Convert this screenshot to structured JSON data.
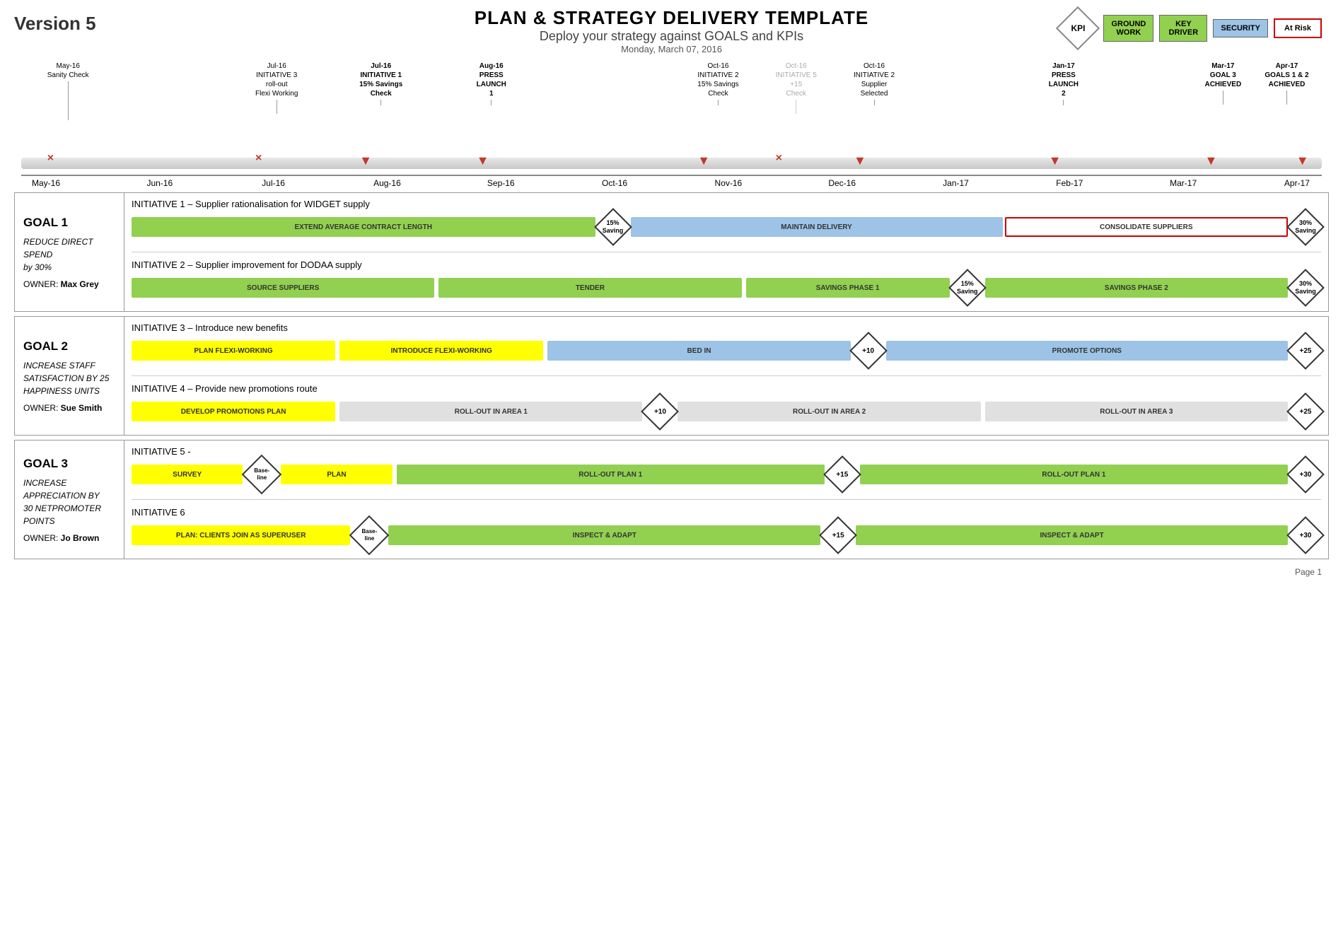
{
  "header": {
    "title": "PLAN & STRATEGY DELIVERY TEMPLATE",
    "subtitle": "Deploy your strategy against GOALS and KPIs",
    "date": "Monday, March 07, 2016",
    "version": "Version 5",
    "kpi_label": "KPI"
  },
  "legend": [
    {
      "id": "ground-work",
      "label": "GROUND\nWORK",
      "bg": "#92d050",
      "color": "#000"
    },
    {
      "id": "key-driver",
      "label": "KEY\nDRIVER",
      "bg": "#92d050",
      "color": "#000"
    },
    {
      "id": "security",
      "label": "SECURITY",
      "bg": "#9dc3e6",
      "color": "#000"
    },
    {
      "id": "at-risk",
      "label": "At Risk",
      "bg": "#fff",
      "color": "#c00",
      "border": "#c00"
    }
  ],
  "timeline": {
    "months": [
      "May-16",
      "Jun-16",
      "Jul-16",
      "Aug-16",
      "Sep-16",
      "Oct-16",
      "Nov-16",
      "Dec-16",
      "Jan-17",
      "Feb-17",
      "Mar-17",
      "Apr-17"
    ],
    "milestones": [
      {
        "date": "May-16",
        "label": "Sanity Check",
        "bold": false,
        "grey": false,
        "marker": "x",
        "pos": 0
      },
      {
        "date": "Jul-16",
        "label": "INITIATIVE 3\nroll-out\nFlexi Working",
        "bold": false,
        "grey": false,
        "marker": "x",
        "pos": 16.5
      },
      {
        "date": "Jul-16",
        "label": "INITIATIVE 1\n15% Savings\nCheck",
        "bold": true,
        "grey": false,
        "marker": "arrow",
        "pos": 24
      },
      {
        "date": "Aug-16",
        "label": "PRESS\nLAUNCH\n1",
        "bold": true,
        "grey": false,
        "marker": "arrow",
        "pos": 33
      },
      {
        "date": "Oct-16",
        "label": "INITIATIVE 2\n15% Savings\nCheck",
        "bold": false,
        "grey": false,
        "marker": "arrow",
        "pos": 50
      },
      {
        "date": "Oct-16",
        "label": "INITIATIVE 5\n+15\nCheck",
        "bold": false,
        "grey": true,
        "marker": "x",
        "pos": 57
      },
      {
        "date": "Oct-16",
        "label": "INITIATIVE 2\nSupplier\nSelected",
        "bold": false,
        "grey": false,
        "marker": "arrow",
        "pos": 63
      },
      {
        "date": "Jan-17",
        "label": "PRESS\nLAUNCH\n2",
        "bold": true,
        "grey": false,
        "marker": "arrow",
        "pos": 78
      },
      {
        "date": "Mar-17",
        "label": "GOAL 3\nACHIEVED",
        "bold": true,
        "grey": false,
        "marker": "arrow",
        "pos": 91
      },
      {
        "date": "Apr-17",
        "label": "GOALS 1 & 2\nACHIEVED",
        "bold": true,
        "grey": false,
        "marker": "arrow",
        "pos": 100
      }
    ]
  },
  "goals": [
    {
      "id": "goal1",
      "number": "GOAL 1",
      "description": "REDUCE DIRECT\nSPEND\nby 30%",
      "owner_label": "OWNER:",
      "owner_name": "Max Grey",
      "initiatives": [
        {
          "id": "initiative1",
          "header": "INITIATIVE 1 – Supplier rationalisation for WIDGET supply",
          "bars": [
            {
              "label": "EXTEND AVERAGE CONTRACT LENGTH",
              "type": "green",
              "flex": 5
            },
            {
              "label": "15%\nSaving",
              "type": "diamond"
            },
            {
              "label": "MAINTAIN DELIVERY",
              "type": "blue",
              "flex": 4
            },
            {
              "label": "CONSOLIDATE SUPPLIERS",
              "type": "red-outline",
              "flex": 3
            },
            {
              "label": "30%\nSaving",
              "type": "diamond"
            }
          ]
        },
        {
          "id": "initiative2",
          "header": "INITIATIVE 2 – Supplier improvement for DODAA supply",
          "bars": [
            {
              "label": "SOURCE SUPPLIERS",
              "type": "green",
              "flex": 3
            },
            {
              "label": "TENDER",
              "type": "green",
              "flex": 3
            },
            {
              "label": "SAVINGS PHASE 1",
              "type": "green",
              "flex": 2
            },
            {
              "label": "15%\nSaving",
              "type": "diamond"
            },
            {
              "label": "SAVINGS PHASE 2",
              "type": "green",
              "flex": 3
            },
            {
              "label": "30%\nSaving",
              "type": "diamond"
            }
          ]
        }
      ]
    },
    {
      "id": "goal2",
      "number": "GOAL 2",
      "description": "INCREASE STAFF\nSATISFACTION BY 25\nHAPPINESS UNITS",
      "owner_label": "OWNER:",
      "owner_name": "Sue Smith",
      "initiatives": [
        {
          "id": "initiative3",
          "header": "INITIATIVE 3 – Introduce new benefits",
          "bars": [
            {
              "label": "PLAN FLEXI-WORKING",
              "type": "yellow",
              "flex": 2
            },
            {
              "label": "INTRODUCE FLEXI-WORKING",
              "type": "yellow",
              "flex": 2
            },
            {
              "label": "BED IN",
              "type": "blue",
              "flex": 3
            },
            {
              "label": "+10",
              "type": "diamond"
            },
            {
              "label": "PROMOTE OPTIONS",
              "type": "blue",
              "flex": 4
            },
            {
              "label": "+25",
              "type": "diamond"
            }
          ]
        },
        {
          "id": "initiative4",
          "header": "INITIATIVE 4 – Provide new promotions route",
          "bars": [
            {
              "label": "DEVELOP PROMOTIONS PLAN",
              "type": "yellow",
              "flex": 2
            },
            {
              "label": "ROLL-OUT IN AREA 1",
              "type": "grey",
              "flex": 3
            },
            {
              "label": "+10",
              "type": "diamond"
            },
            {
              "label": "ROLL-OUT IN AREA 2",
              "type": "grey",
              "flex": 3
            },
            {
              "label": "ROLL-OUT IN AREA 3",
              "type": "grey",
              "flex": 3
            },
            {
              "label": "+25",
              "type": "diamond"
            }
          ]
        }
      ]
    },
    {
      "id": "goal3",
      "number": "GOAL 3",
      "description": "INCREASE\nAPPRECIATION BY\n30 NETPROMOTER\nPOINTS",
      "owner_label": "OWNER:",
      "owner_name": "Jo Brown",
      "initiatives": [
        {
          "id": "initiative5",
          "header": "INITIATIVE 5 -",
          "bars": [
            {
              "label": "SURVEY",
              "type": "yellow",
              "flex": 1
            },
            {
              "label": "Base-\nline",
              "type": "diamond-small"
            },
            {
              "label": "PLAN",
              "type": "yellow",
              "flex": 1
            },
            {
              "label": "ROLL-OUT PLAN 1",
              "type": "green",
              "flex": 4
            },
            {
              "label": "+15",
              "type": "diamond"
            },
            {
              "label": "ROLL-OUT PLAN 1",
              "type": "green",
              "flex": 4
            },
            {
              "label": "+30",
              "type": "diamond"
            }
          ]
        },
        {
          "id": "initiative6",
          "header": "INITIATIVE 6",
          "bars": [
            {
              "label": "PLAN: CLIENTS JOIN AS SUPERUSER",
              "type": "yellow",
              "flex": 2
            },
            {
              "label": "Base-\nline",
              "type": "diamond-small"
            },
            {
              "label": "INSPECT & ADAPT",
              "type": "green",
              "flex": 4
            },
            {
              "label": "+15",
              "type": "diamond"
            },
            {
              "label": "INSPECT & ADAPT",
              "type": "green",
              "flex": 4
            },
            {
              "label": "+30",
              "type": "diamond"
            }
          ]
        }
      ]
    }
  ],
  "footer": {
    "page": "Page 1"
  }
}
